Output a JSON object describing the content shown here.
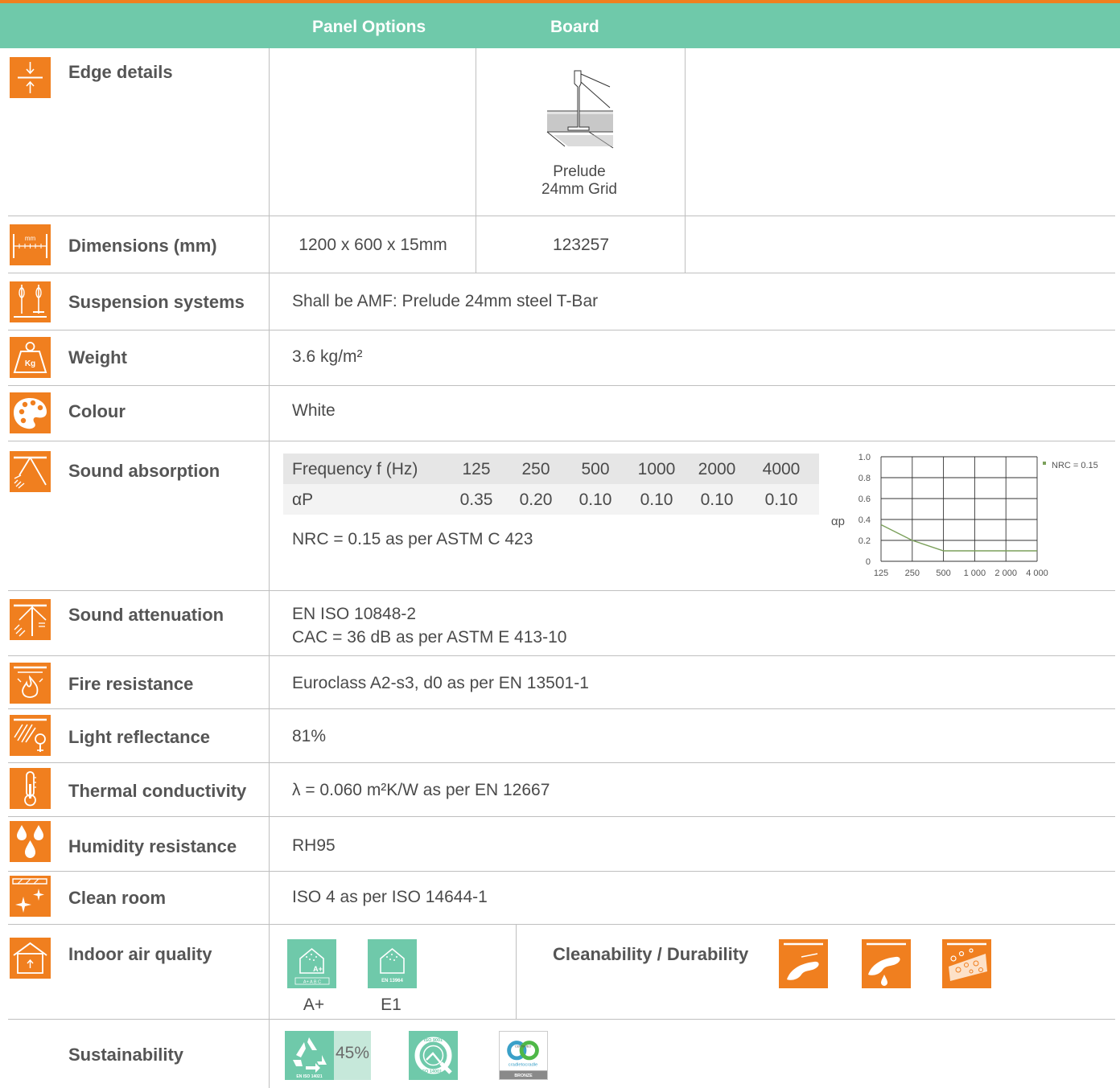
{
  "header": {
    "panel_options": "Panel Options",
    "board": "Board"
  },
  "rows": {
    "edge_details": {
      "label": "Edge details",
      "icon": "edge-arrows-icon",
      "board_caption_line1": "Prelude",
      "board_caption_line2": "24mm Grid"
    },
    "dimensions": {
      "label": "Dimensions (mm)",
      "icon": "ruler-icon",
      "size": "1200 x 600  x 15mm",
      "code": "123257"
    },
    "suspension": {
      "label": "Suspension systems",
      "icon": "suspension-icon",
      "value": "Shall be AMF: Prelude 24mm steel T-Bar"
    },
    "weight": {
      "label": "Weight",
      "icon": "kg-weight-icon",
      "icon_text": "Kg",
      "value": "3.6 kg/m²"
    },
    "colour": {
      "label": "Colour",
      "icon": "palette-icon",
      "value": "White"
    },
    "sound_absorption": {
      "label": "Sound absorption",
      "icon": "sound-absorption-icon",
      "table_header": "Frequency f (Hz)",
      "frequencies": [
        "125",
        "250",
        "500",
        "1000",
        "2000",
        "4000"
      ],
      "alpha_label": "αP",
      "alpha_values": [
        "0.35",
        "0.20",
        "0.10",
        "0.10",
        "0.10",
        "0.10"
      ],
      "nrc_text": "NRC = 0.15 as per ASTM C 423"
    },
    "sound_attenuation": {
      "label": "Sound attenuation",
      "icon": "sound-attenuation-icon",
      "line1": "EN ISO 10848-2",
      "line2": "CAC = 36 dB as per ASTM E 413-10"
    },
    "fire": {
      "label": "Fire resistance",
      "icon": "fire-icon",
      "value": "Euroclass A2-s3, d0 as per EN 13501-1"
    },
    "light": {
      "label": "Light reflectance",
      "icon": "light-reflectance-icon",
      "value": "81%"
    },
    "thermal": {
      "label": "Thermal conductivity",
      "icon": "thermometer-icon",
      "value": "λ = 0.060 m²K/W as per EN 12667"
    },
    "humidity": {
      "label": "Humidity resistance",
      "icon": "water-drops-icon",
      "value": "RH95"
    },
    "clean_room": {
      "label": "Clean room",
      "icon": "sparkle-icon",
      "value": "ISO 4 as per ISO 14644-1"
    },
    "indoor_air": {
      "label": "Indoor air quality",
      "icon": "house-icon",
      "badge1_text": "A+",
      "badge1_scale": "A+ A B C",
      "badge1_caption": "A+",
      "badge2_text": "EN 13964",
      "badge2_caption": "E1",
      "cleanability_label": "Cleanability /  Durability",
      "clean_icons": [
        "wipe-icon",
        "wash-icon",
        "scrub-icon"
      ]
    },
    "sustainability": {
      "label": "Sustainability",
      "recycle_percent": "45%",
      "recycle_caption": "EN ISO 14021",
      "iso_top": "ISO 9001",
      "iso_bottom": "ISO 14001",
      "c2c_top": "CERTIFIED",
      "c2c_mid": "cradletocradle",
      "c2c_bottom": "BRONZE"
    }
  },
  "colors": {
    "orange": "#f07f1f",
    "green": "#6fc9aa",
    "curve": "#7ba05b"
  },
  "chart_data": {
    "type": "line",
    "x": [
      125,
      250,
      500,
      1000,
      2000,
      4000
    ],
    "x_tick_labels": [
      "125",
      "250",
      "500",
      "1 000",
      "2 000",
      "4 000"
    ],
    "series": [
      {
        "name": "NRC = 0.15",
        "values": [
          0.35,
          0.2,
          0.1,
          0.1,
          0.1,
          0.1
        ]
      }
    ],
    "ylabel": "αp",
    "ylim": [
      0,
      1.0
    ],
    "y_ticks": [
      0,
      0.2,
      0.4,
      0.6,
      0.8,
      1.0
    ],
    "y_tick_labels": [
      "0",
      "0.2",
      "0.4",
      "0.6",
      "0.8",
      "1.0"
    ],
    "x_scale": "log",
    "grid": true,
    "legend": "top-right"
  }
}
